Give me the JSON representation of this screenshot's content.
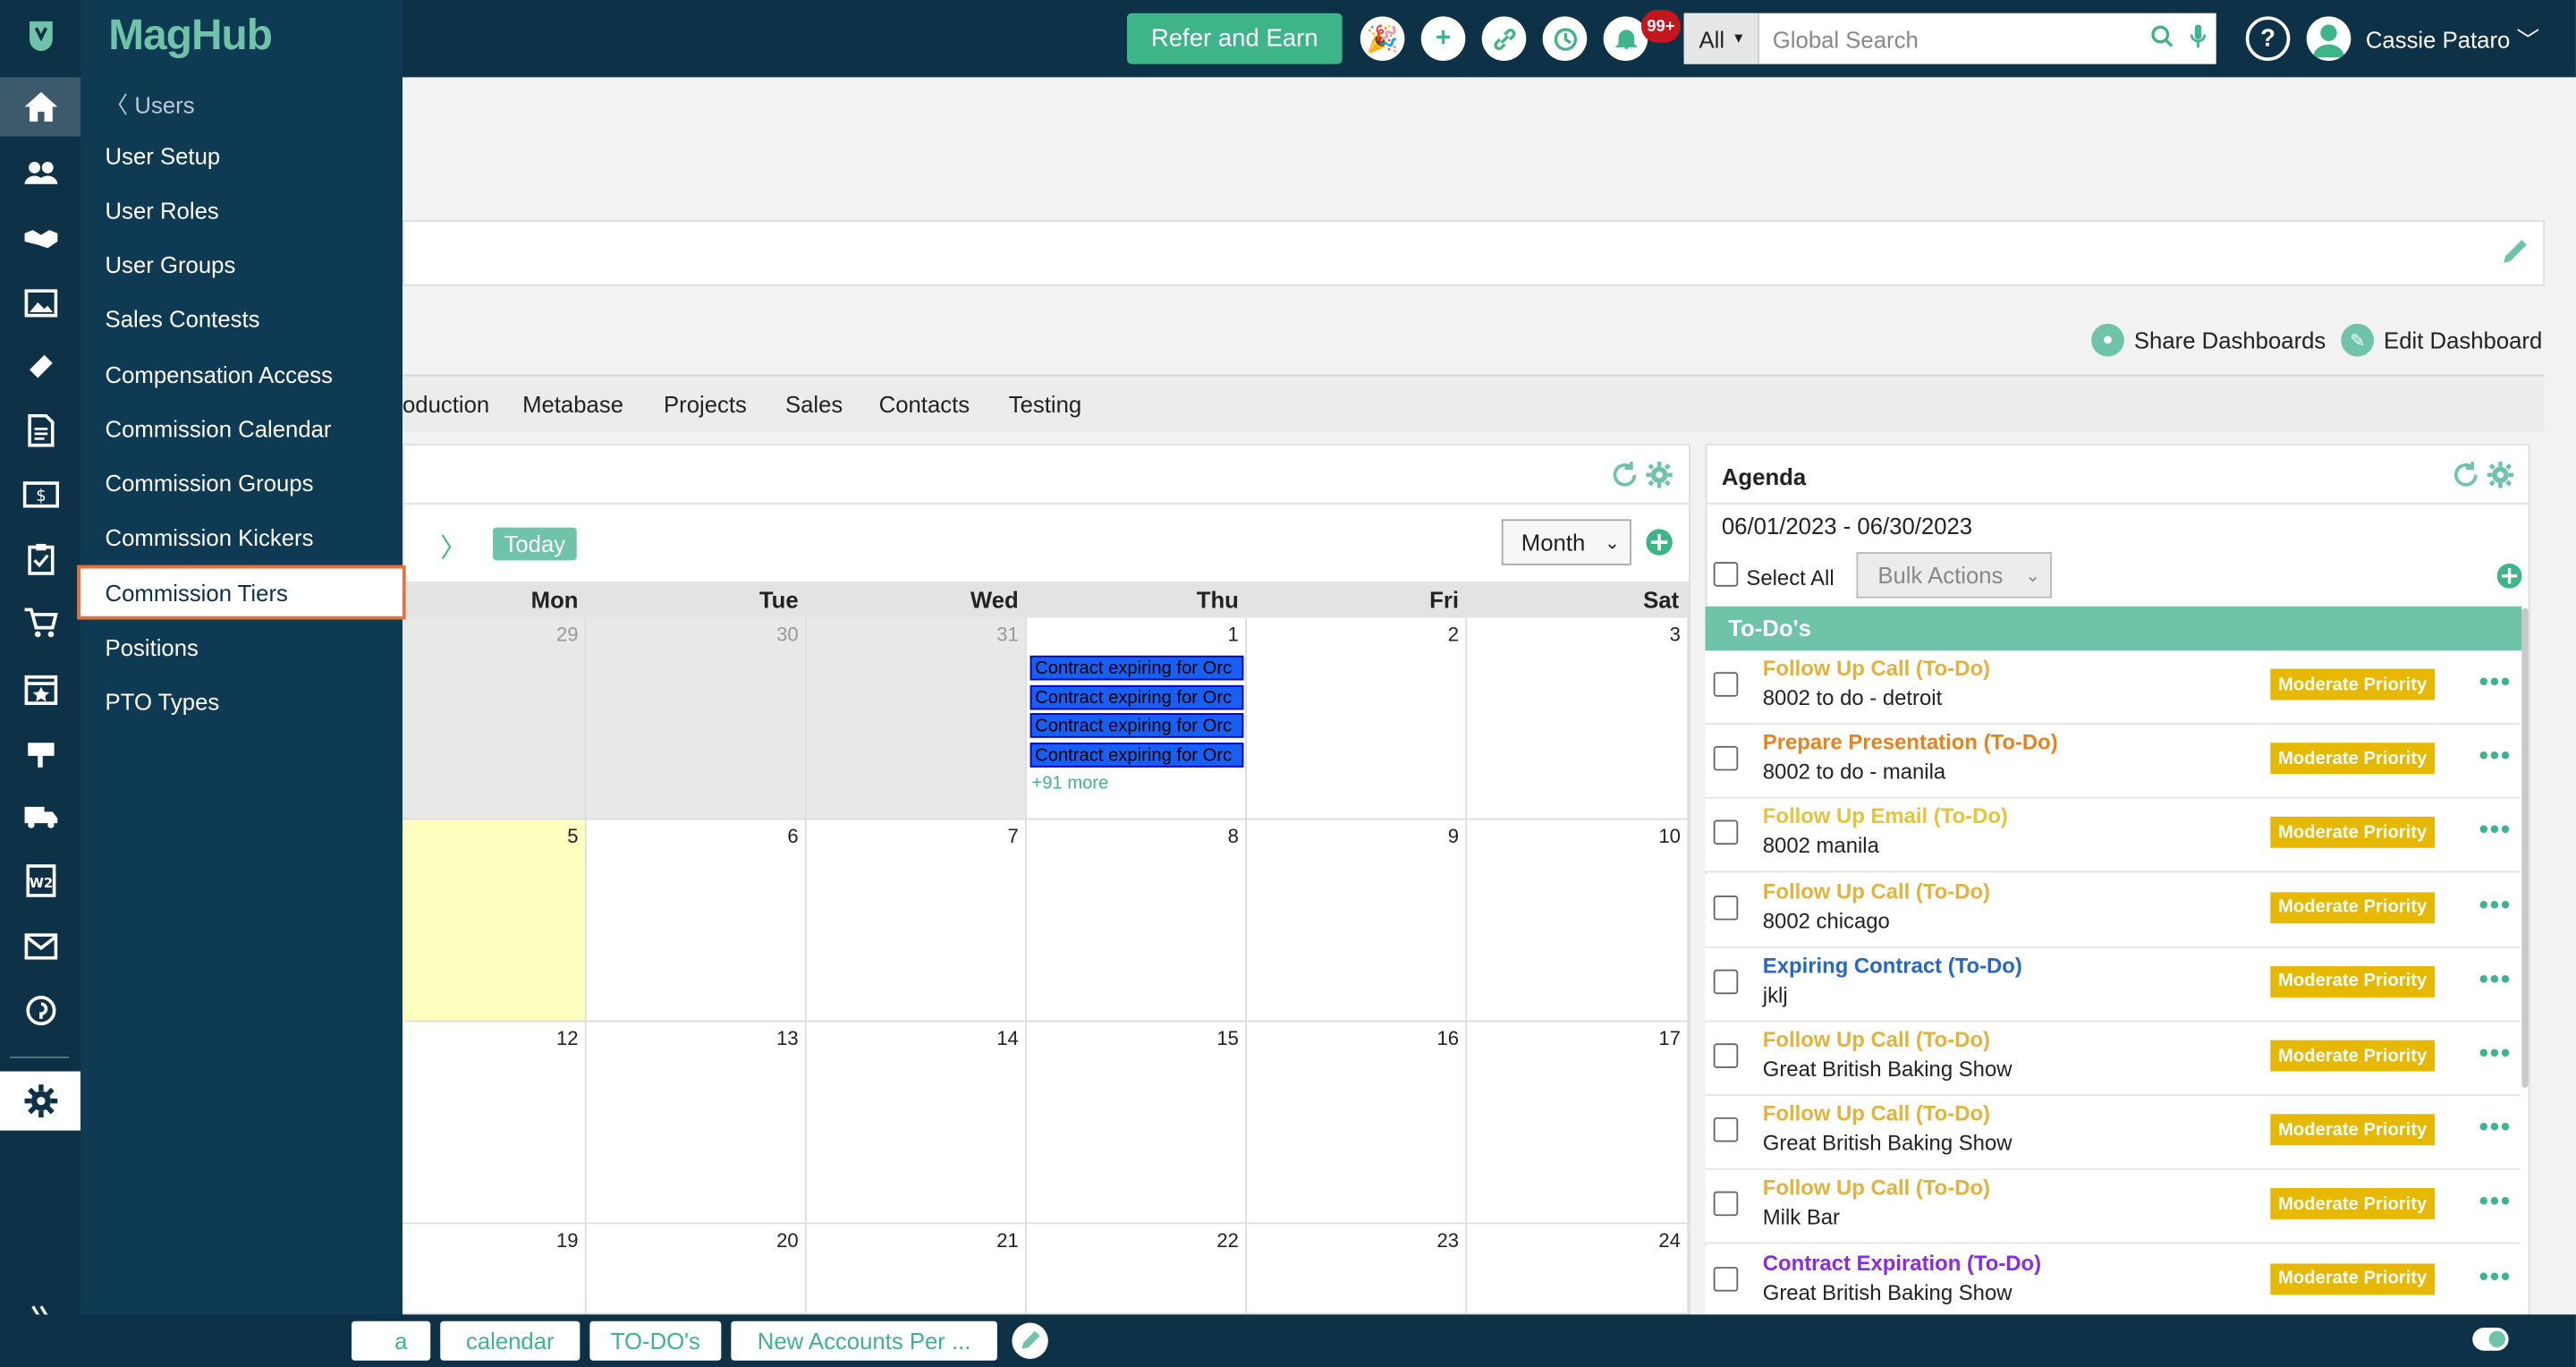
{
  "app": {
    "logo": "MagHub"
  },
  "topbar": {
    "refer_label": "Refer and Earn",
    "notifications_badge": "99+",
    "search_scope": "All",
    "search_placeholder": "Global Search",
    "help_label": "?",
    "user_name": "Cassie Pataro"
  },
  "slide_menu": {
    "back_label": "Users",
    "items": [
      "User Setup",
      "User Roles",
      "User Groups",
      "Sales Contests",
      "Compensation Access",
      "Commission Calendar",
      "Commission Groups",
      "Commission Kickers",
      "Commission Tiers",
      "Positions",
      "PTO Types"
    ],
    "selected": "Commission Tiers"
  },
  "dashboard": {
    "share_label": "Share Dashboards",
    "edit_label": "Edit Dashboard",
    "tabs": [
      "oduction",
      "Metabase",
      "Projects",
      "Sales",
      "Contacts",
      "Testing"
    ]
  },
  "calendar": {
    "today_label": "Today",
    "view_select": "Month",
    "day_names": [
      "Mon",
      "Tue",
      "Wed",
      "Thu",
      "Fri",
      "Sat"
    ],
    "weeks": [
      [
        "29",
        "30",
        "31",
        "1",
        "2",
        "3"
      ],
      [
        "5",
        "6",
        "7",
        "8",
        "9",
        "10"
      ],
      [
        "12",
        "13",
        "14",
        "15",
        "16",
        "17"
      ],
      [
        "19",
        "20",
        "21",
        "22",
        "23",
        "24"
      ]
    ],
    "events": [
      "Contract expiring for Orc",
      "Contract expiring for Orc",
      "Contract expiring for Orc",
      "Contract expiring for Orc"
    ],
    "more_label": "+91 more"
  },
  "agenda": {
    "title": "Agenda",
    "range": "06/01/2023 - 06/30/2023",
    "select_all": "Select All",
    "bulk_actions": "Bulk Actions",
    "section": "To-Do's",
    "items": [
      {
        "title": "Follow Up Call (To-Do)",
        "sub": "8002 to do - detroit",
        "priority": "Moderate Priority",
        "color": "#e3b23c"
      },
      {
        "title": "Prepare Presentation (To-Do)",
        "sub": "8002 to do - manila",
        "priority": "Moderate Priority",
        "color": "#e8821e"
      },
      {
        "title": "Follow Up Email (To-Do)",
        "sub": "8002 manila",
        "priority": "Moderate Priority",
        "color": "#e6c33a"
      },
      {
        "title": "Follow Up Call (To-Do)",
        "sub": "8002 chicago",
        "priority": "Moderate Priority",
        "color": "#e3b23c"
      },
      {
        "title": "Expiring Contract (To-Do)",
        "sub": "jklj",
        "priority": "Moderate Priority",
        "color": "#2767c9"
      },
      {
        "title": "Follow Up Call (To-Do)",
        "sub": "Great British Baking Show",
        "priority": "Moderate Priority",
        "color": "#e3b23c"
      },
      {
        "title": "Follow Up Call (To-Do)",
        "sub": "Great British Baking Show",
        "priority": "Moderate Priority",
        "color": "#e3b23c"
      },
      {
        "title": "Follow Up Call (To-Do)",
        "sub": "Milk Bar",
        "priority": "Moderate Priority",
        "color": "#e3b23c"
      },
      {
        "title": "Contract Expiration (To-Do)",
        "sub": "Great British Baking Show",
        "priority": "Moderate Priority",
        "color": "#8a2be2"
      }
    ]
  },
  "bottom_tabs": [
    "a",
    "calendar",
    "TO-DO's",
    "New Accounts Per ..."
  ],
  "colors": {
    "brand_dark": "#0d3147",
    "accent_green": "#3eb489",
    "priority": "#e6b800",
    "selected_border": "#e8703a"
  }
}
